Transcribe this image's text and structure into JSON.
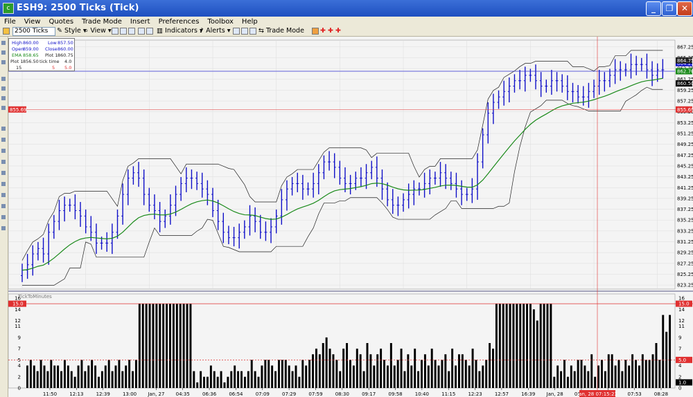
{
  "window": {
    "title": "ESH9: 2500 Ticks (Tick)",
    "app_icon": "chart-app-icon",
    "minimize": "_",
    "maximize": "❐",
    "close": "✕"
  },
  "menu": [
    "File",
    "View",
    "Quotes",
    "Trade Mode",
    "Insert",
    "Preferences",
    "Toolbox",
    "Help"
  ],
  "toolbar": {
    "interval": "2500 Ticks",
    "style": "Style",
    "view": "View",
    "indicators": "Indicators",
    "alerts": "Alerts",
    "trade_mode": "Trade Mode"
  },
  "info": {
    "high_l": "High",
    "high": "860.00",
    "low_l": "Low",
    "low": "857.50",
    "open_l": "Open",
    "open": "859.00",
    "close_l": "Close",
    "close": "860.00",
    "ema_l": "EMA",
    "ema": "858.65",
    "p1_l": "Plot 1",
    "p1": "860.75",
    "p1b_l": "Plot 1",
    "p1b": "856.50",
    "tt_l": "tick time",
    "tt": "4.0",
    "n1": "15",
    "n2": "5",
    "n3": "5.0"
  },
  "colors": {
    "bar": "#1010c8",
    "ema": "#1a8a1a",
    "band": "#222222",
    "volume": "#000000",
    "cursor": "#e03030"
  },
  "chart_data": [
    {
      "type": "ohlc",
      "title": "",
      "ylim": [
        822.5,
        868.5
      ],
      "y_ticks": [
        "867.25",
        "865.25",
        "863.25",
        "861.25",
        "859.25",
        "857.25",
        "855.25",
        "853.25",
        "851.25",
        "849.25",
        "847.25",
        "845.25",
        "843.25",
        "841.25",
        "839.25",
        "837.25",
        "835.25",
        "833.25",
        "831.25",
        "829.25",
        "827.25",
        "825.25",
        "823.25"
      ],
      "horizontal_line": 862.75,
      "cursor_price": "855.69",
      "right_labels": [
        {
          "label": "862.76",
          "value": 862.75,
          "color": "#1a8a1a"
        },
        {
          "label": "864.25",
          "value": 864.25,
          "color": "#1010c8"
        },
        {
          "label": "864.75",
          "value": 864.75,
          "color": "#222222"
        },
        {
          "label": "860.50",
          "value": 860.5,
          "color": "#000000"
        }
      ],
      "closes": [
        826,
        827,
        829,
        830,
        829,
        833,
        835,
        837,
        838,
        838,
        837,
        836,
        834,
        833,
        831,
        831,
        831,
        833,
        836,
        840,
        843,
        844,
        843,
        840,
        838,
        837,
        835,
        836,
        838,
        840,
        842,
        843,
        843,
        842,
        841,
        840,
        837,
        835,
        833,
        832,
        832,
        833,
        834,
        836,
        835,
        833,
        833,
        834,
        836,
        839,
        841,
        842,
        842,
        841,
        841,
        842,
        844,
        846,
        846,
        845,
        843,
        842,
        842,
        843,
        843,
        844,
        845,
        843,
        841,
        839,
        838,
        838,
        839,
        840,
        841,
        841,
        842,
        843,
        843,
        844,
        843,
        842,
        841,
        840,
        840,
        841,
        846,
        851,
        855,
        857,
        858,
        859,
        860,
        861,
        861,
        862,
        862,
        861,
        860,
        860,
        861,
        861,
        860,
        859,
        859,
        858,
        858,
        859,
        860,
        861,
        861,
        862,
        863,
        863,
        863,
        864,
        864,
        864,
        863,
        862,
        863,
        863
      ]
    },
    {
      "type": "bar",
      "title": "TickToMinutes",
      "ylim": [
        0,
        16
      ],
      "y_ticks": [
        "16",
        "14",
        "12",
        "11",
        "9",
        "7",
        "5",
        "4",
        "2",
        "0"
      ],
      "upper_line": "15.0",
      "lower_line": "5.0",
      "current_value": "1.0",
      "x_ticks": [
        "11:50",
        "12:13",
        "12:39",
        "13:00",
        "Jan, 27",
        "04:35",
        "06:36",
        "06:54",
        "07:09",
        "07:29",
        "07:59",
        "08:30",
        "09:17",
        "09:58",
        "10:40",
        "11:15",
        "12:23",
        "12:57",
        "16:39",
        "Jan, 28",
        "05:19",
        "06:37",
        "07:53",
        "08:28"
      ],
      "cursor_time": "Jan, 28 07:15:23",
      "values": [
        4,
        5,
        4,
        3,
        5,
        4,
        3,
        5,
        4,
        4,
        3,
        5,
        4,
        3,
        2,
        4,
        5,
        3,
        4,
        5,
        4,
        2,
        3,
        4,
        5,
        3,
        4,
        5,
        3,
        4,
        5,
        3,
        5,
        15,
        15,
        15,
        15,
        15,
        15,
        15,
        15,
        15,
        15,
        15,
        15,
        15,
        15,
        15,
        15,
        3,
        1,
        3,
        2,
        2,
        4,
        3,
        2,
        3,
        1,
        2,
        3,
        4,
        3,
        3,
        2,
        3,
        5,
        3,
        2,
        4,
        5,
        5,
        4,
        3,
        5,
        5,
        5,
        4,
        3,
        4,
        2,
        5,
        4,
        5,
        6,
        7,
        6,
        8,
        9,
        7,
        6,
        5,
        3,
        7,
        8,
        5,
        4,
        7,
        6,
        3,
        8,
        6,
        4,
        6,
        7,
        5,
        4,
        8,
        4,
        5,
        7,
        3,
        6,
        4,
        7,
        3,
        5,
        6,
        4,
        7,
        5,
        4,
        5,
        6,
        3,
        7,
        4,
        6,
        6,
        5,
        4,
        7,
        5,
        3,
        4,
        5,
        8,
        7,
        15,
        15,
        15,
        15,
        15,
        15,
        15,
        15,
        15,
        15,
        15,
        14,
        12,
        15,
        15,
        15,
        15,
        2,
        4,
        3,
        5,
        2,
        4,
        3,
        5,
        5,
        4,
        3,
        6,
        2,
        4,
        5,
        3,
        6,
        6,
        4,
        5,
        3,
        5,
        4,
        6,
        5,
        4,
        6,
        5,
        5,
        6,
        8,
        5,
        13,
        10,
        13
      ]
    }
  ]
}
